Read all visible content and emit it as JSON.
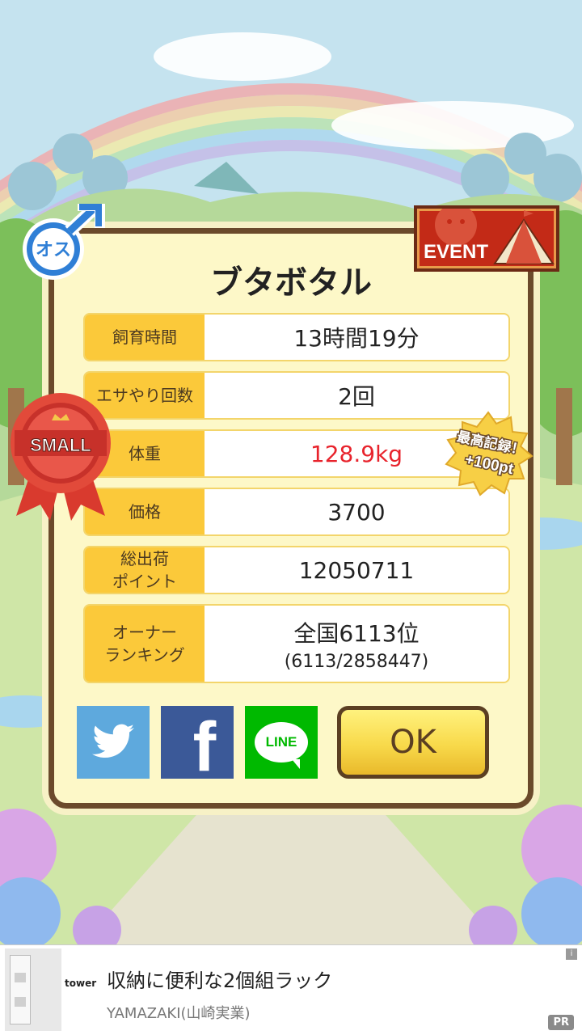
{
  "pig": {
    "name": "ブタボタル",
    "gender_label": "オス",
    "size_badge": "SMALL",
    "event_label": "EVENT",
    "record_badge_line1": "最高記録！",
    "record_badge_line2": "+100pt"
  },
  "stats": [
    {
      "label": "飼育時間",
      "value": "13時間19分"
    },
    {
      "label": "エサやり回数",
      "value": "2回"
    },
    {
      "label": "体重",
      "value": "128.9kg"
    },
    {
      "label": "価格",
      "value": "3700"
    },
    {
      "label": "総出荷\nポイント",
      "value": "12050711"
    },
    {
      "label": "オーナー\nランキング",
      "value": "全国6113位",
      "sub": "(6113/2858447)"
    }
  ],
  "share": {
    "twitter": "twitter",
    "facebook": "f",
    "line": "LINE"
  },
  "ok_label": "OK",
  "ad": {
    "thumb_label": "tower",
    "title": "収納に便利な2個組ラック",
    "sponsor": "YAMAZAKI(山崎実業)",
    "pr": "PR",
    "info": "i"
  },
  "colors": {
    "weight_highlight": "#e8232c",
    "label_bg": "#fbc93a",
    "frame": "#6b4a2b"
  }
}
